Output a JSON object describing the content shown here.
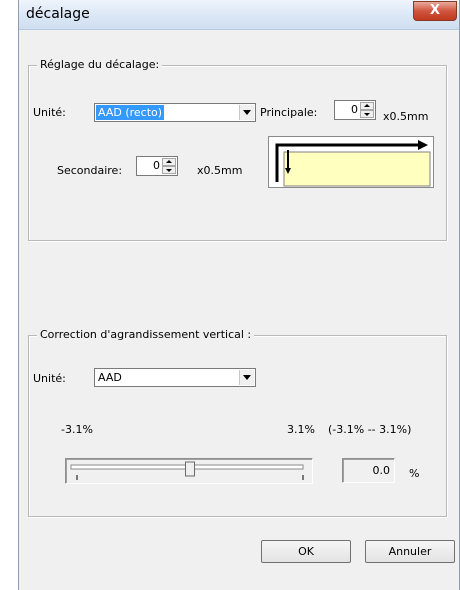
{
  "window": {
    "title": "décalage",
    "close_glyph": "X"
  },
  "offset_group": {
    "legend": "Réglage du décalage:",
    "unit_label": "Unité:",
    "unit_value": "AAD (recto)",
    "principal_label": "Principale:",
    "principal_value": "0",
    "principal_unit": "x0.5mm",
    "secondary_label": "Secondaire:",
    "secondary_value": "0",
    "secondary_unit": "x0.5mm"
  },
  "correction_group": {
    "legend": "Correction d'agrandissement vertical :",
    "unit_label": "Unité:",
    "unit_value": "AAD",
    "min_label": "-3.1%",
    "max_label": "3.1%",
    "range_label": "(-3.1% -- 3.1%)",
    "slider_position": 0.5,
    "value": "0.0",
    "value_unit": "%"
  },
  "buttons": {
    "ok": "OK",
    "cancel": "Annuler"
  }
}
